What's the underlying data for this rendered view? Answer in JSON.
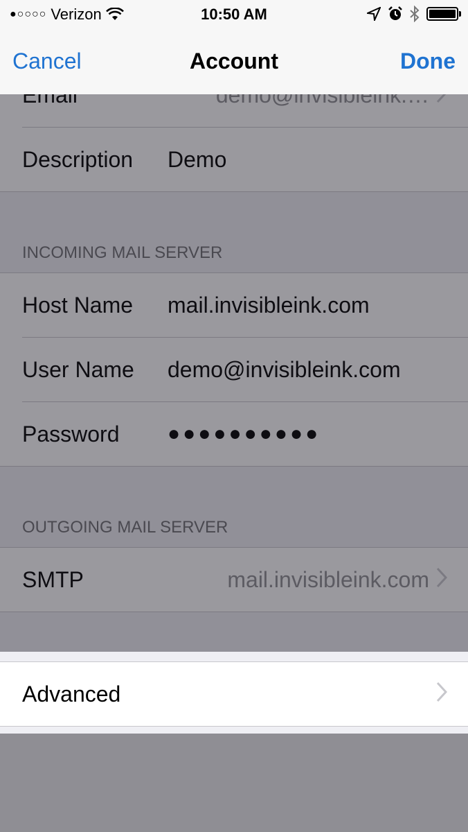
{
  "status_bar": {
    "signal_dots": "●○○○○",
    "carrier": "Verizon",
    "time": "10:50 AM",
    "icons": [
      "wifi-icon",
      "location-arrow-icon",
      "alarm-icon",
      "bluetooth-icon",
      "battery-icon"
    ]
  },
  "nav": {
    "cancel_label": "Cancel",
    "title": "Account",
    "done_label": "Done"
  },
  "account_group": {
    "rows": [
      {
        "label": "Email",
        "value": "demo@invisibleink.…"
      },
      {
        "label": "Description",
        "value": "Demo"
      }
    ]
  },
  "incoming": {
    "header": "INCOMING MAIL SERVER",
    "rows": [
      {
        "label": "Host Name",
        "value": "mail.invisibleink.com"
      },
      {
        "label": "User Name",
        "value": "demo@invisibleink.com"
      },
      {
        "label": "Password",
        "value": "●●●●●●●●●●"
      }
    ]
  },
  "outgoing": {
    "header": "OUTGOING MAIL SERVER",
    "smtp_label": "SMTP",
    "smtp_value": "mail.invisibleink.com"
  },
  "advanced": {
    "label": "Advanced"
  },
  "colors": {
    "accent": "#1f73d1",
    "background": "#efeff4",
    "separator": "#c8c7cc"
  }
}
